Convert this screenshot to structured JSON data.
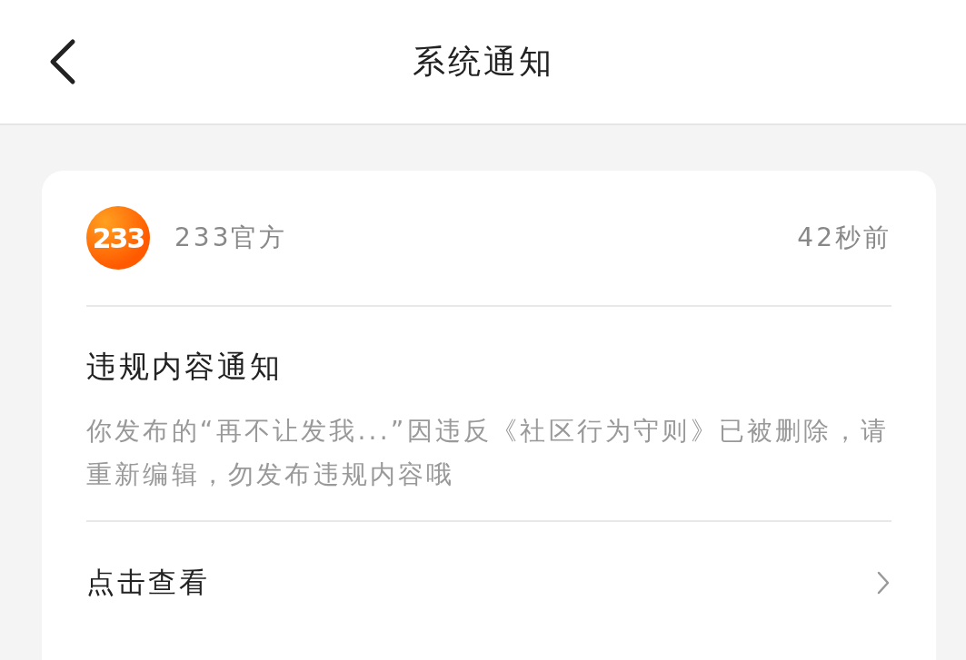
{
  "header": {
    "title": "系统通知"
  },
  "notification": {
    "logo_text": "233",
    "sender": "233官方",
    "time": "42秒前",
    "title": "违规内容通知",
    "body": "你发布的“再不让发我...”因违反《社区行为守则》已被删除，请重新编辑，勿发布违规内容哦",
    "action": "点击查看"
  }
}
